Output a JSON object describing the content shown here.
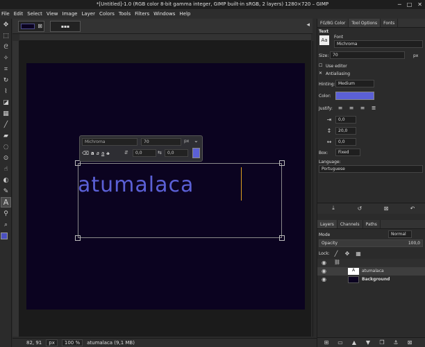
{
  "window": {
    "title": "*[Untitled]-1.0 (RGB color 8-bit gamma integer, GIMP built-in sRGB, 2 layers) 1280×720 – GIMP"
  },
  "menu": [
    "File",
    "Edit",
    "Select",
    "View",
    "Image",
    "Layer",
    "Colors",
    "Tools",
    "Filters",
    "Windows",
    "Help"
  ],
  "canvas": {
    "text": "atumalaca"
  },
  "overlay": {
    "font": "Michroma",
    "size": "70",
    "unit": "px",
    "baseline": "0,0",
    "kerning": "0,0"
  },
  "status": {
    "coords": "82, 91",
    "unit": "px",
    "zoom": "100 %",
    "info": "atumalaca (9,1 MB)"
  },
  "dock": {
    "tabs": [
      "FG/BG Color",
      "Tool Options",
      "Fonts"
    ],
    "section_title": "Text",
    "font_label": "Font",
    "font_value": "Michroma",
    "size_label": "Size:",
    "size_value": "70",
    "size_unit": "px",
    "use_editor": "Use editor",
    "antialiasing": "Antialiasing",
    "hinting_label": "Hinting:",
    "hinting_value": "Medium",
    "color_label": "Color:",
    "justify_label": "Justify:",
    "indent": "0,0",
    "line_spacing": "20,0",
    "letter_spacing": "0,0",
    "box_label": "Box:",
    "box_value": "Fixed",
    "language_label": "Language:",
    "language_value": "Portuguese",
    "text_color": "#5b60d6"
  },
  "layers": {
    "tabs": [
      "Layers",
      "Channels",
      "Paths"
    ],
    "mode_label": "Mode",
    "mode_value": "Normal",
    "opacity_label": "Opacity",
    "opacity_value": "100,0",
    "lock_label": "Lock:",
    "items": [
      "atumalaca",
      "Background"
    ]
  }
}
